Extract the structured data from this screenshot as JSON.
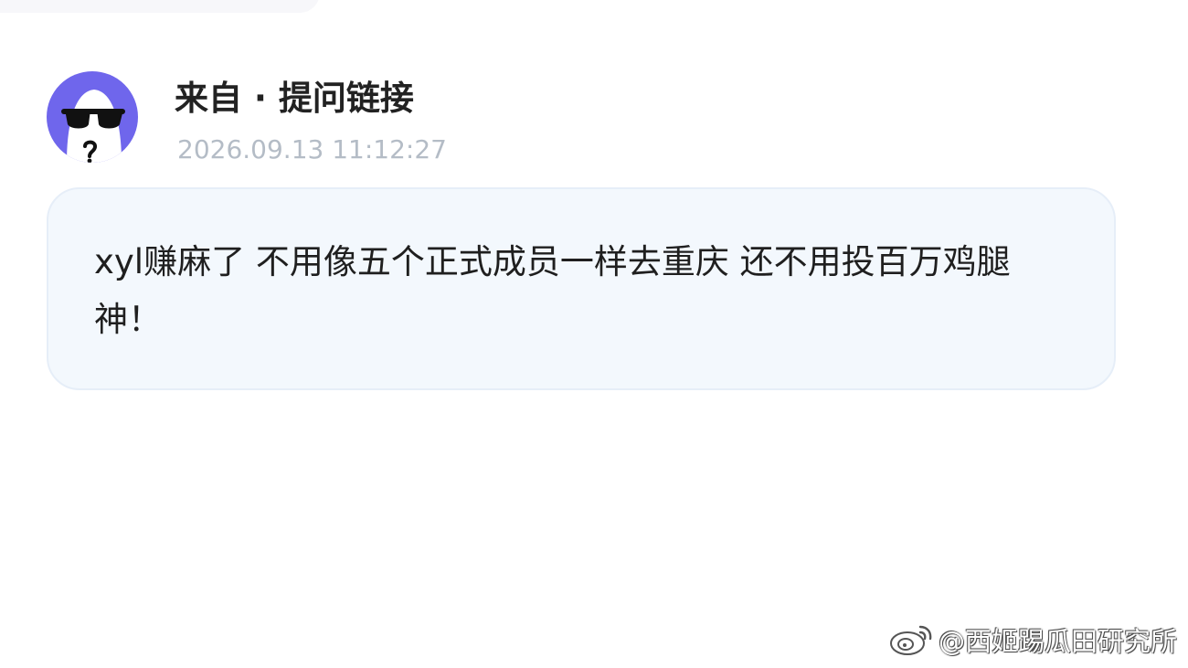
{
  "post": {
    "author": "来自 · 提问链接",
    "timestamp": "2026.09.13 11:12:27",
    "avatar_icon": "sunglasses-ghost-avatar",
    "avatar_color": "#6f66ec",
    "message": "xyl赚麻了 不用像五个正式成员一样去重庆 还不用投百万鸡腿 神！"
  },
  "watermark": {
    "icon": "weibo-logo-icon",
    "text": "@西姬踢瓜田研究所"
  },
  "colors": {
    "card_background": "#f3f8fd",
    "timestamp": "#b4bcc6",
    "text": "#1f1f1f"
  }
}
